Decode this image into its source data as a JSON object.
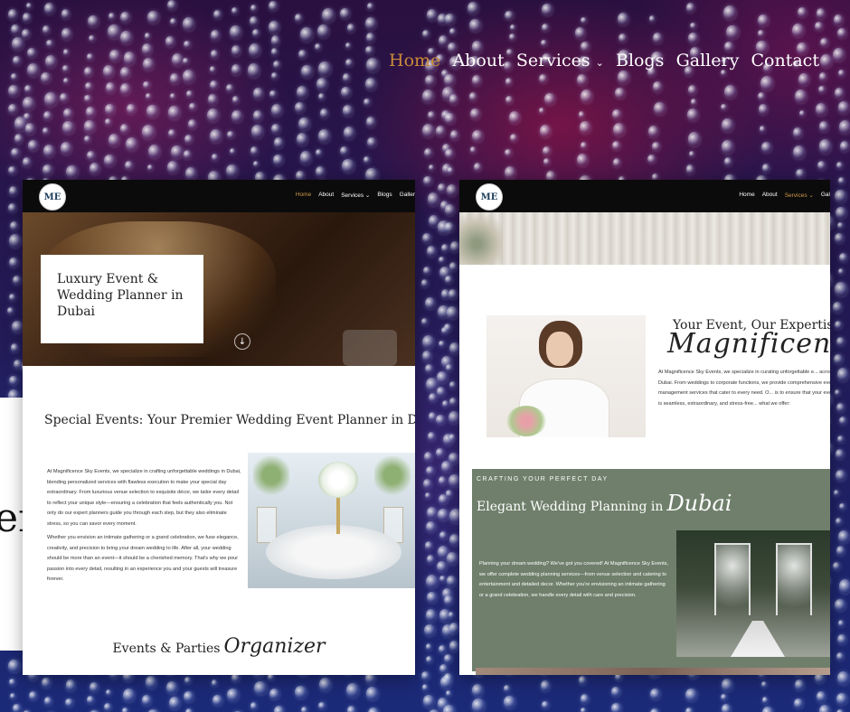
{
  "nav": {
    "items": [
      "Home",
      "About",
      "Services",
      "Blogs",
      "Gallery",
      "Contact"
    ],
    "active": "Home",
    "services_chevron": "⌄"
  },
  "background_text": "er",
  "colors": {
    "accent": "#c98a3a",
    "sage_green": "#6f7f6b",
    "dark_nav": "#0b0b0b"
  },
  "left_mockup": {
    "logo": "ME",
    "nav": [
      "Home",
      "About",
      "Services ⌄",
      "Blogs",
      "Galler"
    ],
    "hero_title": "Luxury Event & Wedding Planner in Dubai",
    "scroll_icon": "↓",
    "heading": "Special Events: Your Premier Wedding Event Planner in Dubai",
    "paragraph_1": "At Magnificence Sky Events, we specialize in crafting unforgettable weddings in Dubai, blending personalized services with flawless execution to make your special day extraordinary. From luxurious venue selection to exquisite décor, we tailor every detail to reflect your unique style—ensuring a celebration that feels authentically you. Not only do our expert planners guide you through each step, but they also eliminate stress, so you can savor every moment.",
    "paragraph_2": "Whether you envision an intimate gathering or a grand celebration, we fuse elegance, creativity, and precision to bring your dream wedding to life. After all, your wedding should be more than an event—it should be a cherished memory. That's why we pour passion into every detail, resulting in an experience you and your guests will treasure forever.",
    "footer_text": "Events & Parties",
    "footer_script": "Organizer"
  },
  "right_mockup": {
    "logo": "ME",
    "nav": [
      "Home",
      "About",
      "Services ⌄",
      "Gal"
    ],
    "active_nav": "Services ⌄",
    "heading": "Your Event, Our Expertise –",
    "script_heading": "Magnificence Sky",
    "paragraph": "At Magnificence Sky Events, we specialize in curating unforgettable e... across Dubai. From weddings to corporate functions, we provide comprehensive event management services that cater to every need. O... is to ensure that your event is seamless, extraordinary, and stress-free... what we offer:",
    "kicker": "CRAFTING YOUR PERFECT DAY",
    "green_heading": "Elegant Wedding Planning in",
    "green_script": "Dubai",
    "green_paragraph": "Planning your dream wedding? We've got you covered! At Magnificence Sky Events, we offer complete wedding planning services—from venue selection and catering to entertainment and detailed decor. Whether you're envisioning an intimate gathering or a grand celebration, we handle every detail with care and precision."
  }
}
